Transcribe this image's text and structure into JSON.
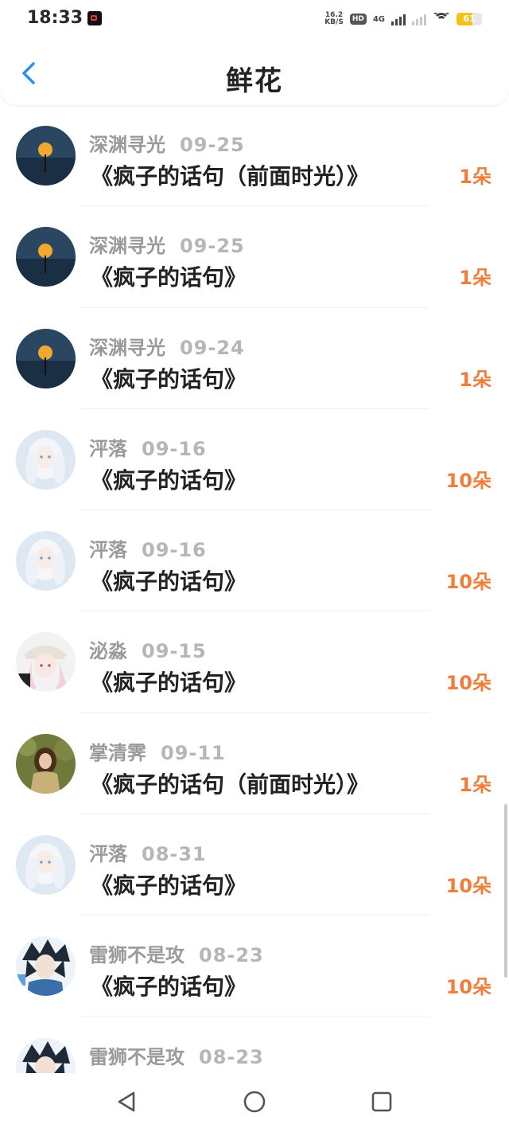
{
  "status_bar": {
    "time": "18:33",
    "speed_value": "16.2",
    "speed_unit": "KB/S",
    "hd_label": "HD",
    "network": "4G",
    "battery": "61",
    "battery_level": 0.61
  },
  "header": {
    "back_icon": "chevron-left-icon",
    "title": "鲜花"
  },
  "records": [
    {
      "user": "深渊寻光",
      "date": "09-25",
      "work": "《疯子的话句（前面时光）》",
      "amount": "1朵",
      "avatar": "moon-avatar"
    },
    {
      "user": "深渊寻光",
      "date": "09-25",
      "work": "《疯子的话句》",
      "amount": "1朵",
      "avatar": "moon-avatar"
    },
    {
      "user": "深渊寻光",
      "date": "09-24",
      "work": "《疯子的话句》",
      "amount": "1朵",
      "avatar": "moon-avatar"
    },
    {
      "user": "泙落",
      "date": "09-16",
      "work": "《疯子的话句》",
      "amount": "10朵",
      "avatar": "white-hair-girl-avatar"
    },
    {
      "user": "泙落",
      "date": "09-16",
      "work": "《疯子的话句》",
      "amount": "10朵",
      "avatar": "white-hair-girl-avatar"
    },
    {
      "user": "泌淼",
      "date": "09-15",
      "work": "《疯子的话句》",
      "amount": "10朵",
      "avatar": "anime-hat-girl-avatar"
    },
    {
      "user": "掌清霁",
      "date": "09-11",
      "work": "《疯子的话句（前面时光）》",
      "amount": "1朵",
      "avatar": "forest-girl-avatar"
    },
    {
      "user": "泙落",
      "date": "08-31",
      "work": "《疯子的话句》",
      "amount": "10朵",
      "avatar": "white-hair-girl-avatar"
    },
    {
      "user": "雷狮不是攻",
      "date": "08-23",
      "work": "《疯子的话句》",
      "amount": "10朵",
      "avatar": "dark-hair-boy-avatar"
    },
    {
      "user": "雷狮不是攻",
      "date": "08-23",
      "work": "",
      "amount": "",
      "avatar": "dark-hair-boy-avatar"
    }
  ],
  "nav": {
    "back_icon": "triangle-back-icon",
    "home_icon": "circle-home-icon",
    "recents_icon": "square-recents-icon"
  },
  "colors": {
    "accent_back": "#2a8ff0",
    "amount": "#f07e3a",
    "name": "#9a9a9a",
    "date": "#b6b6b6"
  }
}
